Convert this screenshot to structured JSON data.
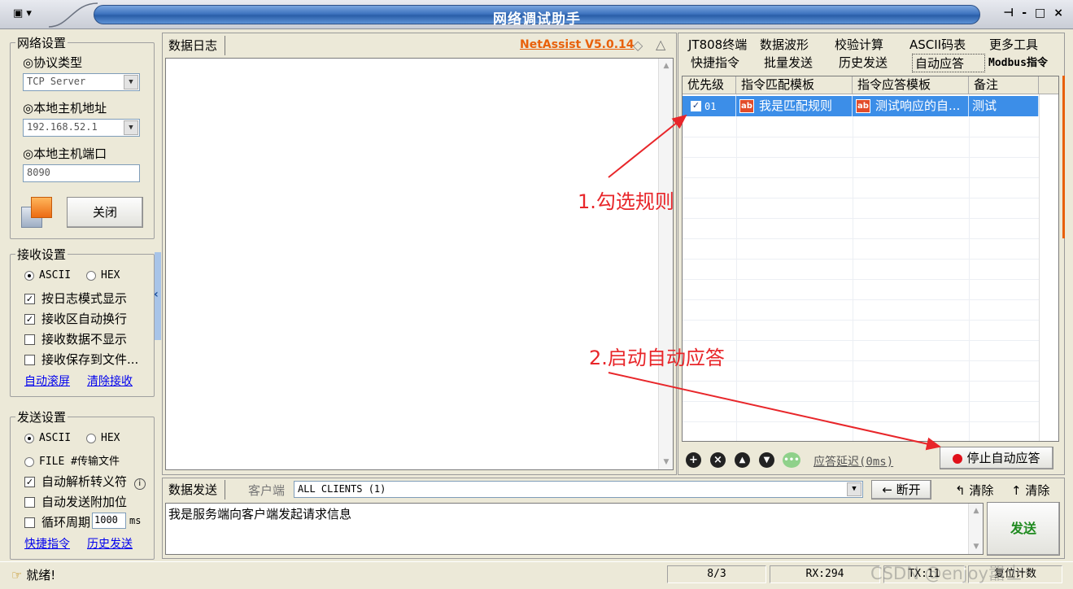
{
  "window": {
    "title": "网络调试助手",
    "controls": [
      "-",
      "□",
      "×"
    ]
  },
  "network": {
    "legend": "网络设置",
    "protocol_label": "◎协议类型",
    "protocol_value": "TCP Server",
    "host_label": "◎本地主机地址",
    "host_value": "192.168.52.1",
    "port_label": "◎本地主机端口",
    "port_value": "8090",
    "close_button": "关闭"
  },
  "receive": {
    "legend": "接收设置",
    "ascii": "ASCII",
    "hex": "HEX",
    "options": [
      {
        "label": "按日志模式显示",
        "checked": true
      },
      {
        "label": "接收区自动换行",
        "checked": true
      },
      {
        "label": "接收数据不显示",
        "checked": false
      },
      {
        "label": "接收保存到文件...",
        "checked": false
      }
    ],
    "link_autoscroll": "自动滚屏",
    "link_clear": "清除接收"
  },
  "send_settings": {
    "legend": "发送设置",
    "ascii": "ASCII",
    "hex": "HEX",
    "file_option": "FILE #传输文件",
    "options": [
      {
        "label": "自动解析转义符",
        "checked": true
      },
      {
        "label": "自动发送附加位",
        "checked": false
      },
      {
        "label": "循环周期",
        "checked": false
      }
    ],
    "cycle_value": "1000",
    "cycle_unit": "ms",
    "link_shortcuts": "快捷指令",
    "link_history": "历史发送"
  },
  "log": {
    "tab": "数据日志",
    "brand": "NetAssist V5.0.14"
  },
  "right_tabs": {
    "row1": [
      "JT808终端",
      "数据波形",
      "校验计算",
      "ASCII码表",
      "更多工具"
    ],
    "row2": [
      "快捷指令",
      "批量发送",
      "历史发送",
      "自动应答",
      "Modbus指令"
    ],
    "active": "自动应答"
  },
  "rules": {
    "columns": [
      "优先级",
      "指令匹配模板",
      "指令应答模板",
      "备注"
    ],
    "rows": [
      {
        "priority": "01",
        "match": "我是匹配规则",
        "response": "测试响应的自...",
        "note": "测试",
        "checked": true
      }
    ],
    "delay_link": "应答延迟(0ms)",
    "stop_button": "停止自动应答"
  },
  "annotations": {
    "step1": "1.勾选规则",
    "step2": "2.启动自动应答"
  },
  "send": {
    "tab": "数据发送",
    "client_label": "客户端",
    "client_value": "ALL CLIENTS (1)",
    "disconnect": "断开",
    "clear1": "清除",
    "clear2": "清除",
    "message": "我是服务端向客户端发起请求信息",
    "send_button": "发送"
  },
  "status": {
    "ready": "就绪!",
    "count": "8/3",
    "rx": "RX:294",
    "tx": "TX:11",
    "reset": "复位计数",
    "watermark": "CSDN @enjoy嚣士"
  },
  "colors": {
    "title_blue": "#3f74c0",
    "selection_blue": "#3c8ee8",
    "annotation_red": "#e8262a",
    "brand_orange": "#e8600a",
    "send_green": "#1f8a1f"
  }
}
